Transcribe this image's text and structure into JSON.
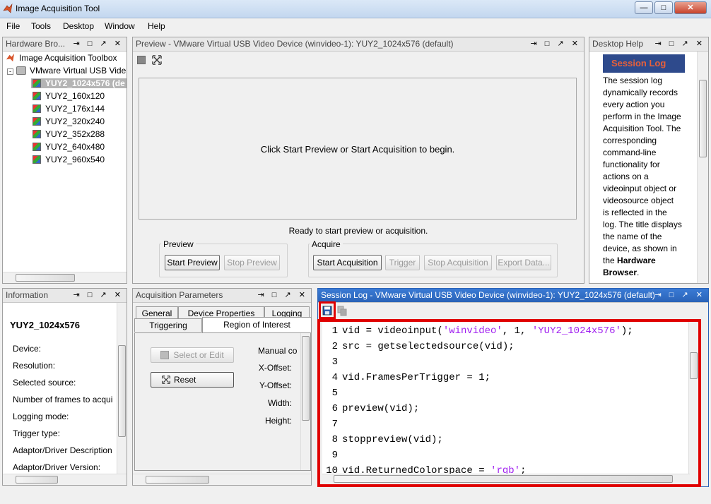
{
  "window": {
    "title": "Image Acquisition Tool"
  },
  "menu": [
    "File",
    "Tools",
    "Desktop",
    "Window",
    "Help"
  ],
  "hardware": {
    "header": "Hardware Bro...",
    "root": "Image Acquisition Toolbox",
    "device": "VMware Virtual USB Vide",
    "formats": [
      "YUY2_1024x576 (de",
      "YUY2_160x120",
      "YUY2_176x144",
      "YUY2_320x240",
      "YUY2_352x288",
      "YUY2_640x480",
      "YUY2_960x540"
    ],
    "selected_index": 0
  },
  "preview": {
    "header": "Preview - VMware Virtual USB Video Device (winvideo-1): YUY2_1024x576 (default)",
    "message": "Click Start Preview or Start Acquisition to begin.",
    "status": "Ready to start preview or acquisition.",
    "preview_group": "Preview",
    "acquire_group": "Acquire",
    "btn_start_preview": "Start Preview",
    "btn_stop_preview": "Stop Preview",
    "btn_start_acq": "Start Acquisition",
    "btn_trigger": "Trigger",
    "btn_stop_acq": "Stop Acquisition",
    "btn_export": "Export Data..."
  },
  "help": {
    "header": "Desktop Help",
    "title": "Session Log",
    "lines": [
      "The session log",
      "dynamically records",
      "every action you",
      "perform in the Image",
      "Acquisition Tool. The",
      "corresponding",
      "command-line",
      "functionality for",
      "actions on a",
      "videoinput object or",
      "videosource object",
      "is reflected in the",
      "log. The title displays",
      "the name of the",
      "device, as shown in",
      "the",
      "Browser."
    ],
    "bold1": "Hardware",
    "bold2": "Browser"
  },
  "information": {
    "header": "Information",
    "title": "YUY2_1024x576",
    "rows": [
      "Device:",
      "Resolution:",
      "Selected source:",
      "Number of frames to acqui",
      "Logging mode:",
      "Trigger type:",
      "Adaptor/Driver Description",
      "Adaptor/Driver Version:"
    ]
  },
  "acq_params": {
    "header": "Acquisition Parameters",
    "tabs_row1": [
      "General",
      "Device Properties",
      "Logging"
    ],
    "tabs_row2": [
      "Triggering",
      "Region of Interest"
    ],
    "active_tab": "Region of Interest",
    "btn_select": "Select or Edit",
    "btn_reset": "Reset",
    "manual": "Manual co",
    "fields": [
      "X-Offset:",
      "Y-Offset:",
      "Width:",
      "Height:"
    ]
  },
  "session_log": {
    "header": "Session Log - VMware Virtual USB Video Device (winvideo-1): YUY2_1024x576 (default)",
    "lines": [
      {
        "n": "1",
        "parts": [
          [
            "vid = videoinput(",
            ""
          ],
          [
            "'winvideo'",
            "str"
          ],
          [
            ", 1, ",
            ""
          ],
          [
            "'YUY2_1024x576'",
            "str"
          ],
          [
            ");",
            ""
          ]
        ]
      },
      {
        "n": "2",
        "parts": [
          [
            "src = getselectedsource(vid);",
            ""
          ]
        ]
      },
      {
        "n": "3",
        "parts": []
      },
      {
        "n": "4",
        "parts": [
          [
            "vid.FramesPerTrigger = 1;",
            ""
          ]
        ]
      },
      {
        "n": "5",
        "parts": []
      },
      {
        "n": "6",
        "parts": [
          [
            "preview(vid);",
            ""
          ]
        ]
      },
      {
        "n": "7",
        "parts": []
      },
      {
        "n": "8",
        "parts": [
          [
            "stoppreview(vid);",
            ""
          ]
        ]
      },
      {
        "n": "9",
        "parts": []
      },
      {
        "n": "10",
        "parts": [
          [
            "vid.ReturnedColorspace = ",
            ""
          ],
          [
            "'rgb'",
            "str"
          ],
          [
            ";",
            ""
          ]
        ]
      }
    ]
  },
  "colors": {
    "highlight": "#e00000",
    "accent": "#2a63b8",
    "string": "#a020f0",
    "help_title_bg": "#2e4a8c",
    "help_title_fg": "#e8603a"
  },
  "icons": {
    "save": "save-icon",
    "copy": "copy-icon",
    "undock": "undock-icon",
    "minimize": "minimize-icon",
    "maximize": "maximize-icon",
    "close": "close-icon"
  }
}
